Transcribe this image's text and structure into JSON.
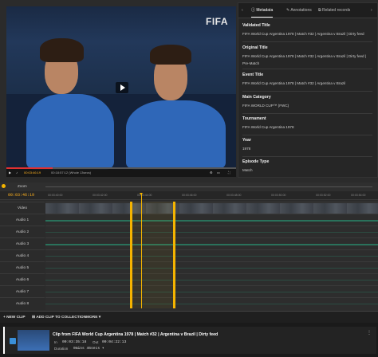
{
  "video": {
    "watermark": "FIFA",
    "timecode": "00:03:46:19",
    "duration_label": "00:18:57:12 (Whole 13secs)",
    "progress_fraction": 0.2
  },
  "panel": {
    "tabs": [
      {
        "label": "Metadata",
        "active": true
      },
      {
        "label": "Annotations",
        "active": false
      },
      {
        "label": "Related records",
        "active": false
      }
    ],
    "fields": [
      {
        "label": "Validated Title",
        "value": "FIFA World Cup Argentina 1978 | Match #32 | Argentina v Brazil | Dirty feed"
      },
      {
        "label": "Original Title",
        "value": "FIFA World Cup Argentina 1978 | Match #32 | Argentina v Brazil | Dirty feed | Pre-Match"
      },
      {
        "label": "Event Title",
        "value": "FIFA World Cup Argentina 1978 | Match #32 | Argentina v Brazil"
      },
      {
        "label": "Main Category",
        "value": "FIFA WORLD CUP™ (FWC)"
      },
      {
        "label": "Tournament",
        "value": "FIFA World Cup Argentina 1978"
      },
      {
        "label": "Year",
        "value": "1978"
      },
      {
        "label": "Episode Type",
        "value": "Match"
      }
    ]
  },
  "timeline": {
    "zoom_label": "Zoom",
    "timecode": "00:03:46:19",
    "ticks": [
      "00:03:40:00",
      "00:03:42:00",
      "00:03:44:00",
      "00:03:46:00",
      "00:03:48:00",
      "00:03:50:00",
      "00:03:52:00",
      "00:03:54:00"
    ],
    "tracks": [
      "Video",
      "Audio 1",
      "Audio 2",
      "Audio 3",
      "Audio 4",
      "Audio 5",
      "Audio 6",
      "Audio 7",
      "Audio 8"
    ],
    "accent": "#f5b400"
  },
  "toolbar": {
    "new_clip": "+ NEW CLIP",
    "add_to_collection": "ADD CLIP TO COLLECTION",
    "more": "MORE ▾"
  },
  "clip": {
    "title": "Clip from FIFA World Cup Argentina 1978 | Match #32 | Argentina v Brazil | Dirty feed",
    "in_label": "In",
    "in_value": "00:03:35:18",
    "out_label": "Out",
    "out_value": "00:04:22:13",
    "duration_label": "Duration",
    "duration_value": "0mins 46secs ▾"
  }
}
